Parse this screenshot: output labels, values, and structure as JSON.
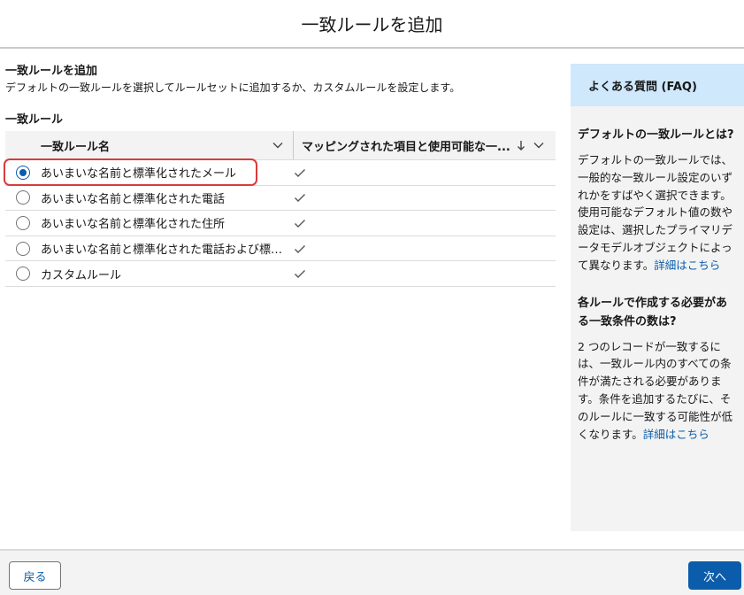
{
  "header": {
    "title": "一致ルールを追加"
  },
  "main": {
    "title": "一致ルールを追加",
    "description": "デフォルトの一致ルールを選択してルールセットに追加するか、カスタムルールを設定します。",
    "subheading": "一致ルール"
  },
  "table": {
    "columns": {
      "name": "一致ルール名",
      "mapped": "マッピングされた項目と使用可能な一..."
    },
    "rows": [
      {
        "name": "あいまいな名前と標準化されたメール",
        "selected": true
      },
      {
        "name": "あいまいな名前と標準化された電話",
        "selected": false
      },
      {
        "name": "あいまいな名前と標準化された住所",
        "selected": false
      },
      {
        "name": "あいまいな名前と標準化された電話および標準化されたメール",
        "selected": false
      },
      {
        "name": "カスタムルール",
        "selected": false
      }
    ]
  },
  "faq": {
    "title": "よくある質問 (FAQ)",
    "q1": "デフォルトの一致ルールとは?",
    "a1": "デフォルトの一致ルールでは、一般的な一致ルール設定のいずれかをすばやく選択できます。使用可能なデフォルト値の数や設定は、選択したプライマリデータモデルオブジェクトによって異なります。",
    "link1": "詳細はこちら",
    "q2": "各ルールで作成する必要がある一致条件の数は?",
    "a2": "2 つのレコードが一致するには、一致ルール内のすべての条件が満たされる必要があります。条件を追加するたびに、そのルールに一致する可能性が低くなります。",
    "link2": "詳細はこちら"
  },
  "footer": {
    "back_label": "戻る",
    "next_label": "次へ"
  },
  "colors": {
    "brand": "#0b5cab",
    "highlight": "#d93b3b",
    "faq_header": "#cfe8fc"
  }
}
